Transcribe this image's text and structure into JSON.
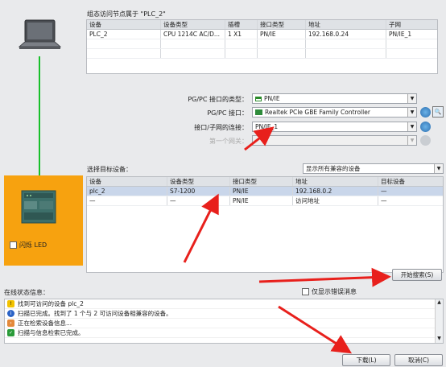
{
  "node_section": {
    "title": "组态访问节点属于 \"PLC_2\"",
    "columns": [
      "设备",
      "设备类型",
      "插槽",
      "接口类型",
      "地址",
      "子网"
    ],
    "rows": [
      [
        "PLC_2",
        "CPU 1214C AC/D...",
        "1 X1",
        "PN/IE",
        "192.168.0.24",
        "PN/IE_1"
      ]
    ]
  },
  "pgpc": {
    "type_label": "PG/PC 接口的类型：",
    "type_value": "PN/IE",
    "interface_label": "PG/PC 接口：",
    "interface_value": "Realtek PCIe GBE Family Controller",
    "subnet_label": "接口/子网的连接：",
    "subnet_value": "PN/IE_1",
    "gateway_label": "第一个网关：",
    "gateway_value": ""
  },
  "target": {
    "label": "选择目标设备：",
    "filter_value": "显示所有兼容的设备",
    "columns": [
      "设备",
      "设备类型",
      "接口类型",
      "地址",
      "目标设备"
    ],
    "rows": [
      [
        "plc_2",
        "S7-1200",
        "PN/IE",
        "192.168.0.2",
        "—"
      ],
      [
        "—",
        "—",
        "PN/IE",
        "访问地址",
        "—"
      ]
    ]
  },
  "flash_led_label": "闪烁 LED",
  "start_search_label": "开始搜索(S)",
  "online_status": {
    "label": "在线状态信息：",
    "only_errors_label": "仅显示错误消息",
    "messages": [
      {
        "icon": "warning-icon",
        "text": "找到可访问的设备 plc_2"
      },
      {
        "icon": "info-icon",
        "text": "扫描已完成。找到了 1 个与 2 可访问设备相兼容的设备。"
      },
      {
        "icon": "search-progress-icon",
        "text": "正在检索设备信息..."
      },
      {
        "icon": "check-icon",
        "text": "扫描与信息检索已完成。"
      }
    ]
  },
  "footer": {
    "download_label": "下载(L)",
    "cancel_label": "取消(C)"
  },
  "colors": {
    "accent_orange": "#f7a20f",
    "link_green": "#18c02a",
    "arrow_red": "#e8201c",
    "selected_row": "#c9d6ea"
  }
}
